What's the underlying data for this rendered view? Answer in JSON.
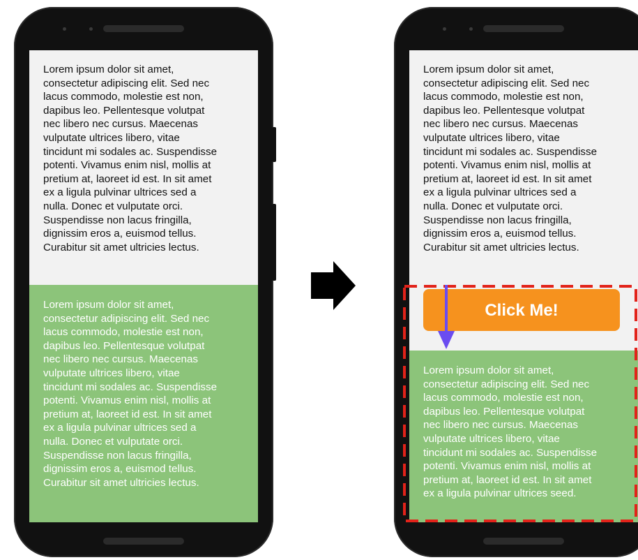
{
  "before": {
    "gray_text": "Lorem ipsum dolor sit amet,\nconsectetur adipiscing elit. Sed nec\nlacus commodo, molestie est non,\ndapibus leo. Pellentesque volutpat\nnec libero nec cursus. Maecenas\nvulputate ultrices libero, vitae\ntincidunt mi sodales ac. Suspendisse\npotenti. Vivamus enim nisl, mollis at\npretium at, laoreet id est. In sit amet\nex a ligula pulvinar ultrices sed a\nnulla. Donec et vulputate orci.\nSuspendisse non lacus fringilla,\ndignissim eros a, euismod tellus.\nCurabitur sit amet ultricies lectus.",
    "green_text": "Lorem ipsum dolor sit amet,\nconsectetur adipiscing elit. Sed nec\nlacus commodo, molestie est non,\ndapibus leo. Pellentesque volutpat\nnec libero nec cursus. Maecenas\nvulputate ultrices libero, vitae\ntincidunt mi sodales ac. Suspendisse\npotenti. Vivamus enim nisl, mollis at\npretium at, laoreet id est. In sit amet\nex a ligula pulvinar ultrices sed a\nnulla. Donec et vulputate orci.\nSuspendisse non lacus fringilla,\ndignissim eros a, euismod tellus.\nCurabitur sit amet ultricies lectus."
  },
  "after": {
    "gray_text": "Lorem ipsum dolor sit amet,\nconsectetur adipiscing elit. Sed nec\nlacus commodo, molestie est non,\ndapibus leo. Pellentesque volutpat\nnec libero nec cursus. Maecenas\nvulputate ultrices libero, vitae\ntincidunt mi sodales ac. Suspendisse\npotenti. Vivamus enim nisl, mollis at\npretium at, laoreet id est. In sit amet\nex a ligula pulvinar ultrices sed a\nnulla. Donec et vulputate orci.\nSuspendisse non lacus fringilla,\ndignissim eros a, euismod tellus.\nCurabitur sit amet ultricies lectus.",
    "button_label": "Click Me!",
    "green_text": "Lorem ipsum dolor sit amet,\nconsectetur adipiscing elit. Sed nec\nlacus commodo, molestie est non,\ndapibus leo. Pellentesque volutpat\nnec libero nec cursus. Maecenas\nvulputate ultrices libero, vitae\ntincidunt mi sodales ac. Suspendisse\npotenti. Vivamus enim nisl, mollis at\npretium at, laoreet id est. In sit amet\nex a ligula pulvinar ultrices seed."
  },
  "colors": {
    "green_block": "#8cc47a",
    "gray_screen": "#f2f2f2",
    "button": "#f6921e",
    "dashed_outline": "#e2231a",
    "shift_arrow": "#6a4cf0",
    "transition_arrow": "#000000"
  },
  "icons": {
    "transition": "right-arrow-icon",
    "shift": "down-arrow-icon"
  }
}
